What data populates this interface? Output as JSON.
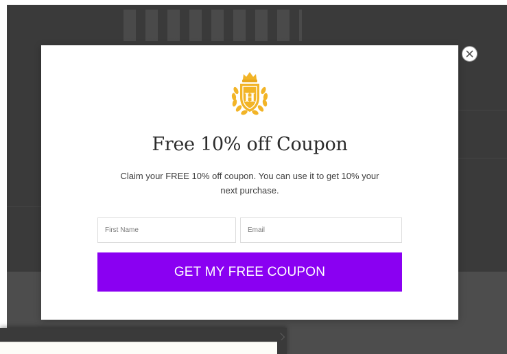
{
  "popup": {
    "title": "Free 10% off Coupon",
    "description": "Claim your FREE 10% off coupon. You can use it to get 10% your next purchase.",
    "first_name_placeholder": "First Name",
    "email_placeholder": "Email",
    "submit_label": "GET MY FREE COUPON",
    "logo_letter": "H",
    "logo_icon": "crest-shield-crown-laurel-icon",
    "close_icon": "close-icon"
  },
  "colors": {
    "accent": "#8a00f2",
    "logo_gold": "#f2b427",
    "overlay": "#3a3a3a"
  }
}
